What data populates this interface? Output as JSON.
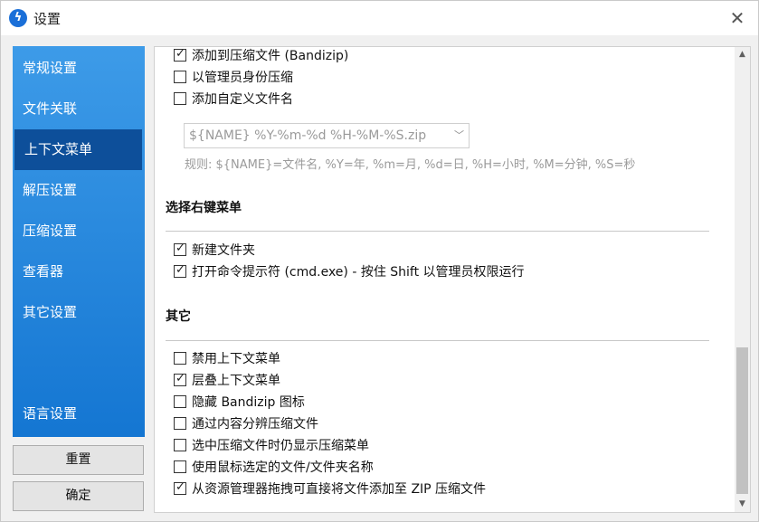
{
  "window": {
    "title": "设置",
    "app_icon": "bandizip-app-icon",
    "close_glyph": "✕"
  },
  "sidebar": {
    "items": [
      {
        "label": "常规设置",
        "active": false
      },
      {
        "label": "文件关联",
        "active": false
      },
      {
        "label": "上下文菜单",
        "active": true
      },
      {
        "label": "解压设置",
        "active": false
      },
      {
        "label": "压缩设置",
        "active": false
      },
      {
        "label": "查看器",
        "active": false
      },
      {
        "label": "其它设置",
        "active": false
      }
    ],
    "language": "语言设置"
  },
  "buttons": {
    "reset": "重置",
    "confirm": "确定"
  },
  "top_options": [
    {
      "label": "添加到压缩文件 (Bandizip)",
      "checked": true
    },
    {
      "label": "以管理员身份压缩",
      "checked": false
    },
    {
      "label": "添加自定义文件名",
      "checked": false
    }
  ],
  "custom_name": {
    "value": "${NAME} %Y-%m-%d %H-%M-%S.zip",
    "rule": "规则: ${NAME}=文件名, %Y=年, %m=月, %d=日, %H=小时, %M=分钟, %S=秒"
  },
  "right_menu": {
    "title": "选择右键菜单",
    "options": [
      {
        "label": "新建文件夹",
        "checked": true
      },
      {
        "label": "打开命令提示符 (cmd.exe) - 按住 Shift 以管理员权限运行",
        "checked": true
      }
    ]
  },
  "other": {
    "title": "其它",
    "options": [
      {
        "label": "禁用上下文菜单",
        "checked": false
      },
      {
        "label": "层叠上下文菜单",
        "checked": true
      },
      {
        "label": "隐藏 Bandizip 图标",
        "checked": false
      },
      {
        "label": "通过内容分辨压缩文件",
        "checked": false
      },
      {
        "label": "选中压缩文件时仍显示压缩菜单",
        "checked": false
      },
      {
        "label": "使用鼠标选定的文件/文件夹名称",
        "checked": false
      },
      {
        "label": "从资源管理器拖拽可直接将文件添加至 ZIP 压缩文件",
        "checked": true
      }
    ]
  },
  "colors": {
    "sidebar_top": "#3d9be8",
    "sidebar_bottom": "#1476d2",
    "sidebar_active": "#0d4f9a"
  }
}
